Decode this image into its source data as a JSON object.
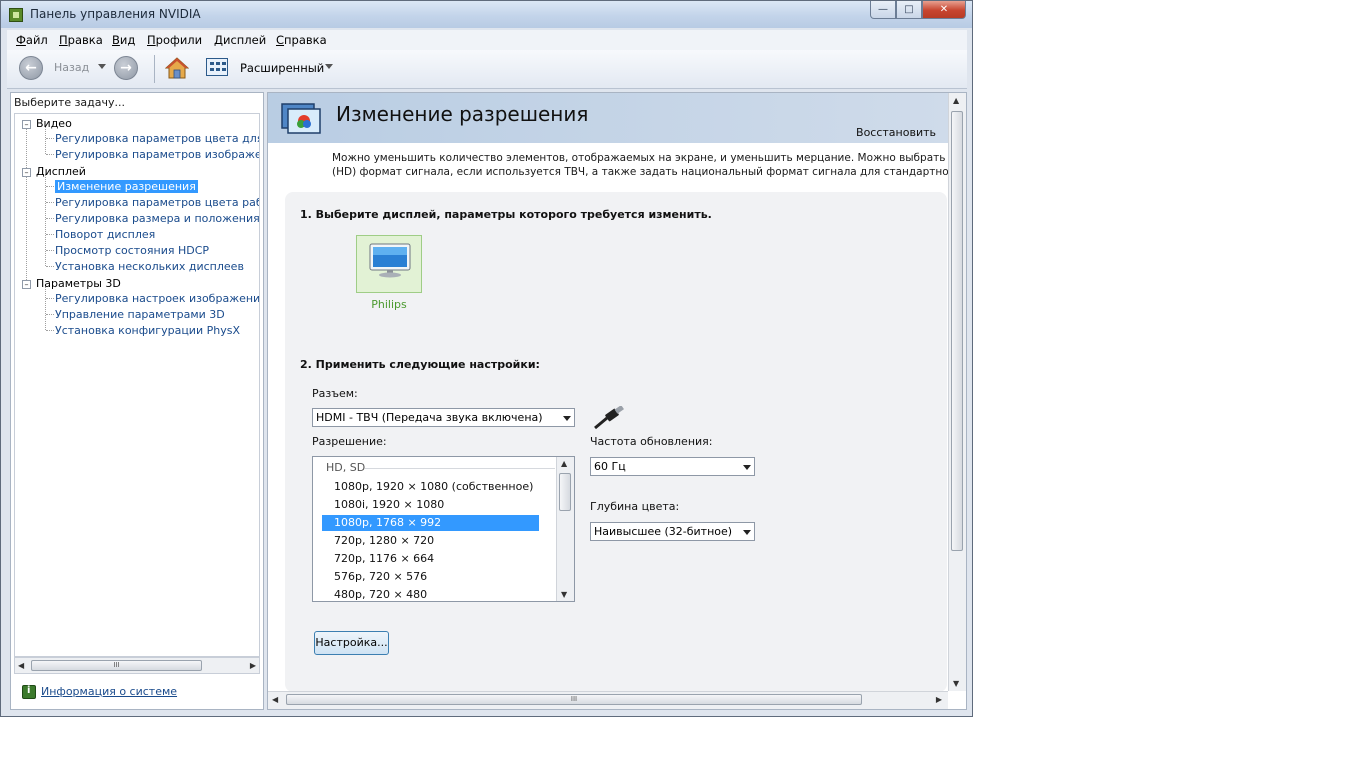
{
  "window": {
    "title": "Панель управления NVIDIA"
  },
  "menu": [
    "Файл",
    "Правка",
    "Вид",
    "Профили",
    "Дисплей",
    "Справка"
  ],
  "toolbar": {
    "back_label": "Назад",
    "view_mode": "Расширенный"
  },
  "sidebar": {
    "task_label": "Выберите задачу...",
    "categories": [
      {
        "label": "Видео",
        "items": [
          "Регулировка параметров цвета для вид",
          "Регулировка параметров изображения д"
        ]
      },
      {
        "label": "Дисплей",
        "items": [
          "Изменение разрешения",
          "Регулировка параметров цвета рабочег",
          "Регулировка размера и положения рабо",
          "Поворот дисплея",
          "Просмотр состояния HDCP",
          "Установка нескольких дисплеев"
        ]
      },
      {
        "label": "Параметры 3D",
        "items": [
          "Регулировка настроек изображения с пр",
          "Управление параметрами 3D",
          "Установка конфигурации PhysX"
        ]
      }
    ],
    "selected": "Изменение разрешения",
    "system_info_link": "Информация о системе"
  },
  "page": {
    "title": "Изменение разрешения",
    "restore_link": "Восстановить",
    "description_line1": "Можно уменьшить количество элементов, отображаемых на экране, и уменьшить мерцание. Можно выбрать высококач",
    "description_line2": "(HD) формат сигнала, если используется ТВЧ, а также задать национальный формат сигнала для стандартного (SD) тел",
    "step1": "1. Выберите дисплей, параметры которого требуется изменить.",
    "display_name": "Philips",
    "step2": "2. Применить следующие настройки:",
    "connector_label": "Разъем:",
    "connector_value": "HDMI - ТВЧ (Передача звука включена)",
    "resolution_label": "Разрешение:",
    "resolution_group": "HD, SD",
    "resolutions": [
      "1080p, 1920 × 1080 (собственное)",
      "1080i, 1920 × 1080",
      "1080p, 1768 × 992",
      "720p, 1280 × 720",
      "720p, 1176 × 664",
      "576p, 720 × 576",
      "480p, 720 × 480"
    ],
    "selected_resolution": "1080p, 1768 × 992",
    "refresh_label": "Частота обновления:",
    "refresh_value": "60 Гц",
    "depth_label": "Глубина цвета:",
    "depth_value": "Наивысшее (32-битное)",
    "settings_button": "Настройка..."
  },
  "colors": {
    "selection": "#3399ff",
    "link": "#1a4b8c",
    "display_card": "#e2f2d5",
    "display_name": "#4a9a2e"
  }
}
